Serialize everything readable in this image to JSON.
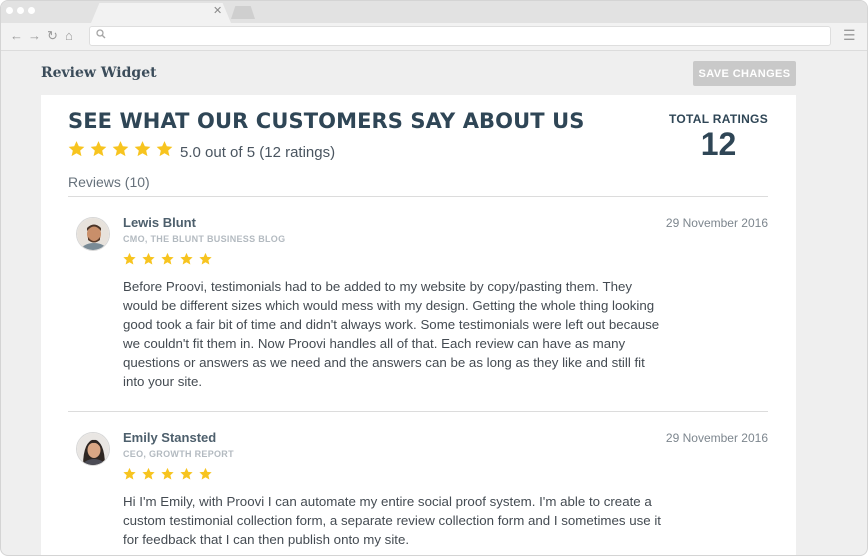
{
  "browser": {
    "tab_close_icon": "close-icon",
    "nav_icons": [
      "back-arrow-icon",
      "forward-arrow-icon",
      "reload-icon",
      "home-icon"
    ],
    "address": {
      "value": "",
      "placeholder": ""
    },
    "menu_icon": "hamburger-menu-icon"
  },
  "app": {
    "title": "Review Widget",
    "save_label": "SAVE CHANGES"
  },
  "widget": {
    "headline": "SEE WHAT OUR CUSTOMERS SAY ABOUT US",
    "rating_stars": 5,
    "rating_summary": "5.0 out of 5 (12 ratings)",
    "total_ratings_label": "TOTAL RATINGS",
    "total_ratings_value": "12",
    "reviews_count": "Reviews (10)",
    "colors": {
      "star": "#f7c41f",
      "heading": "#2f4656",
      "button": "#c9c9c9"
    }
  },
  "reviews": [
    {
      "name": "Lewis Blunt",
      "role": "CMO, THE BLUNT BUSINESS BLOG",
      "date": "29 November 2016",
      "stars": 5,
      "text": "Before Proovi, testimonials had to be added to my website by copy/pasting them. They would be different sizes which would mess with my design. Getting the whole thing looking good took a fair bit of time and didn't always work. Some testimonials were left out because we couldn't fit them in. Now Proovi handles all of that. Each review can have as many questions or answers as we need and the answers can be as long as they like and still fit into your site."
    },
    {
      "name": "Emily Stansted",
      "role": "CEO, GROWTH REPORT",
      "date": "29 November 2016",
      "stars": 5,
      "text": "Hi I'm Emily, with Proovi I can automate my entire social proof system. I'm able to create a custom testimonial collection form, a separate review collection form and I sometimes use it for feedback that I can then publish onto my site."
    }
  ]
}
